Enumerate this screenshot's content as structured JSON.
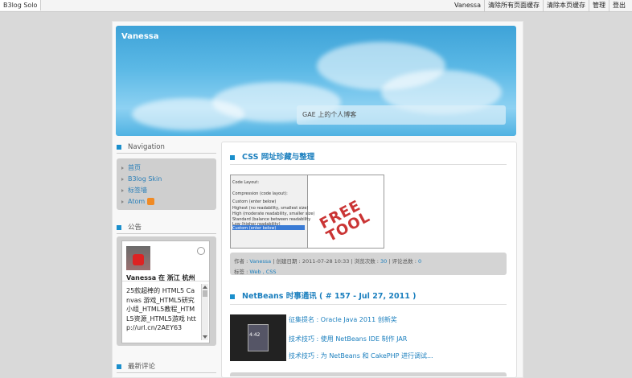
{
  "topbar": {
    "brand": "B3log Solo",
    "links": [
      "Vanessa",
      "清除所有页面缓存",
      "清除本页缓存",
      "管理",
      "登出"
    ]
  },
  "header": {
    "title": "Vanessa",
    "subtitle": "GAE 上的个人博客"
  },
  "sidebar": {
    "navigation_title": "Navigation",
    "nav_items": [
      "首页",
      "B3log Skin",
      "标签墙",
      "Atom"
    ],
    "announcement_title": "公告",
    "weibo_name": "Vanessa 在 浙江 杭州",
    "weibo_text": "25款超棒的 HTML5 Canvas 游戏_HTML5研究小组_HTML5教程_HTML5资源_HTML5游戏 http://url.cn/2AEY63",
    "recent_comments_title": "最新评论"
  },
  "posts": [
    {
      "title": "CSS 网址珍藏与整理",
      "image_stamp": "FREE TOOL",
      "image_panel_rows": [
        "Code Layout:",
        "Compression (code layout):",
        "Custom (enter below)",
        "Highest (no readability, smallest size)",
        "High (moderate readability, smaller size)",
        "Standard (balance between readability",
        "Low (higher readability)",
        "Custom (enter below)"
      ],
      "meta_author_label": "作者 :",
      "author": "Vanessa",
      "created_label": "| 创建日期 : 2011-07-28 10:33 | 浏览次数 :",
      "views": "30",
      "comments_label": "| 评论总数 :",
      "comments": "0",
      "tags_label": "标签 :",
      "tags": "Web , CSS"
    },
    {
      "title": "NetBeans 时事通讯 ( # 157 - Jul 27, 2011 )",
      "phone_clock": "4:42",
      "links": [
        "征集提名 : Oracle Java 2011 创新奖",
        "技术技巧 : 使用 NetBeans IDE 制作 JAR",
        "技术技巧 : 为 NetBeans 和 CakePHP 进行调试..."
      ]
    }
  ],
  "colors": {
    "accent": "#1b8fcc",
    "link": "#1b7fbe"
  }
}
